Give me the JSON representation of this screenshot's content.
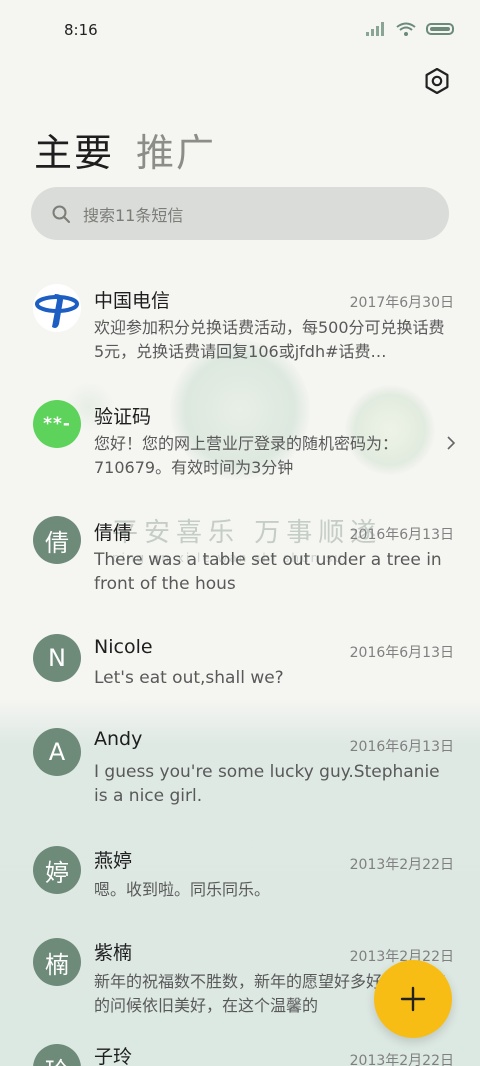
{
  "status_bar": {
    "time": "8:16"
  },
  "tabs": [
    {
      "label": "主要",
      "active": true
    },
    {
      "label": "推广",
      "active": false
    }
  ],
  "search": {
    "placeholder": "搜索11条短信"
  },
  "watermark": {
    "text": "平安喜乐 万事顺遂",
    "pinyin": "ping an xi le wan shi shun sui"
  },
  "messages": [
    {
      "title": "中国电信",
      "date": "2017年6月30日",
      "preview": "欢迎参加积分兑换话费活动，每500分可兑换话费5元，兑换话费请回复106或jfdh#话费…",
      "avatar_text": "",
      "avatar_icon": "china-telecom-logo-icon"
    },
    {
      "title": "验证码",
      "date": "",
      "preview": "您好！您的网上营业厅登录的随机密码为：710679。有效时间为3分钟",
      "avatar_text": "**-",
      "avatar_color": "#5ed35b"
    },
    {
      "title": "倩倩",
      "date": "2016年6月13日",
      "preview": "There was a table set out under a tree in front of the hous",
      "avatar_text": "倩"
    },
    {
      "title": "Nicole",
      "date": "2016年6月13日",
      "preview": "Let's eat out,shall we?",
      "avatar_text": "N"
    },
    {
      "title": "Andy",
      "date": "2016年6月13日",
      "preview": "I guess you're some lucky guy.Stephanie is a nice girl.",
      "avatar_text": "A"
    },
    {
      "title": "燕婷",
      "date": "2013年2月22日",
      "preview": "嗯。收到啦。同乐同乐。",
      "avatar_text": "婷"
    },
    {
      "title": "紫楠",
      "date": "2013年2月22日",
      "preview": "新年的祝福数不胜数，新年的愿望好多好多，新年的问候依旧美好，在这个温馨的",
      "avatar_text": "楠"
    },
    {
      "title": "子玲",
      "date": "2013年2月22日",
      "preview": "",
      "avatar_text": "玲"
    }
  ],
  "colors": {
    "accent": "#f7bd14",
    "avatar": "#6e8b7a",
    "verification_avatar": "#5ed35b"
  }
}
